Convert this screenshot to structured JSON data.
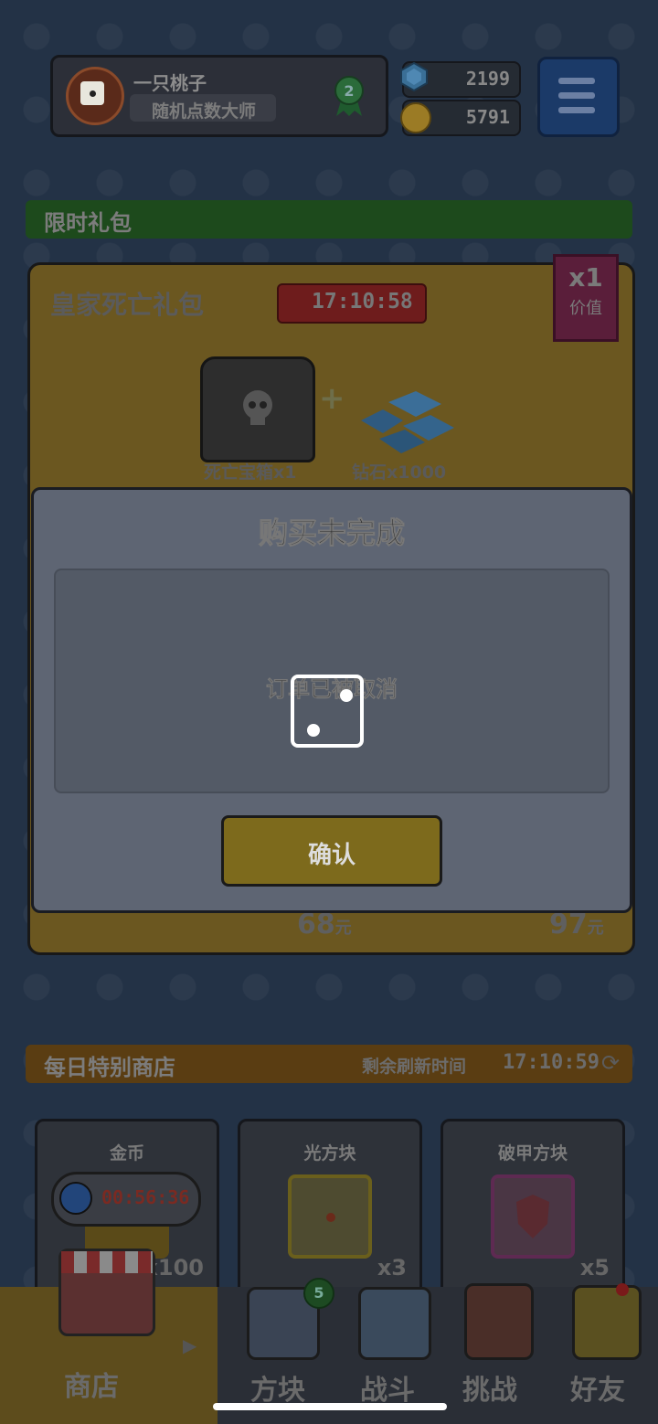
{
  "profile": {
    "name": "一只桃子",
    "title": "随机点数大师",
    "rank_badge": "2"
  },
  "currency": {
    "gems": "2199",
    "coins": "5791"
  },
  "limited_gift": {
    "section_title": "限时礼包",
    "pack_name": "皇家死亡礼包",
    "timer": "17:10:58",
    "value_multiplier": "x1",
    "value_label": "价值",
    "items": [
      {
        "label": "死亡宝箱x1"
      },
      {
        "label": "钻石x1000"
      }
    ],
    "price": "68",
    "price_unit": "元",
    "original_price": "97",
    "original_unit": "元"
  },
  "dialog": {
    "title": "购买未完成",
    "message": "订单已被取消",
    "confirm_label": "确认"
  },
  "daily_shop": {
    "section_title": "每日特别商店",
    "refresh_label": "剩余刷新时间",
    "refresh_timer": "17:10:59",
    "items": [
      {
        "name": "金币",
        "qty": "x100",
        "timer": "00:56:36"
      },
      {
        "name": "光方块",
        "qty": "x3"
      },
      {
        "name": "破甲方块",
        "qty": "x5"
      }
    ]
  },
  "bottom_nav": {
    "items": [
      {
        "label": "商店",
        "active": true
      },
      {
        "label": "方块",
        "badge": "5"
      },
      {
        "label": "战斗"
      },
      {
        "label": "挑战"
      },
      {
        "label": "好友"
      }
    ]
  },
  "colors": {
    "dim_overlay": "#1d2a38",
    "dialog_bg": "#5e6573",
    "confirm_button": "#7d6a1c",
    "loader": "#ffffff"
  }
}
